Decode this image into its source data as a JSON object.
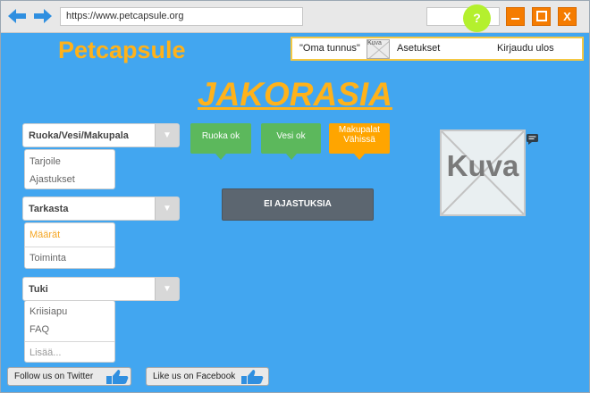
{
  "browser": {
    "url": "https://www.petcapsule.org",
    "help_label": "?",
    "minimize_label": "_",
    "maximize_label": "□",
    "close_label": "X"
  },
  "header": {
    "logo": "Petcapsule",
    "nav": {
      "my_id": "\"Oma tunnus\"",
      "thumb_label": "Kuva",
      "settings": "Asetukset",
      "logout": "Kirjaudu ulos"
    }
  },
  "main": {
    "title": "JAKORASIA",
    "status": [
      {
        "label": "Ruoka ok",
        "color": "#5cb85c"
      },
      {
        "label": "Vesi ok",
        "color": "#5cb85c"
      },
      {
        "label_line1": "Makupalat",
        "label_line2": "Vähissä",
        "color": "#ffa500"
      }
    ],
    "schedule_button": "EI AJASTUKSIA",
    "image_label": "Kuva"
  },
  "sidebar": {
    "dropdown1": {
      "label": "Ruoka/Vesi/Makupala",
      "items": [
        "Tarjoile",
        "Ajastukset"
      ]
    },
    "dropdown2": {
      "label": "Tarkasta",
      "items": [
        "Määrät",
        "Toiminta"
      ],
      "active_color": "#f5a623"
    },
    "dropdown3": {
      "label": "Tuki",
      "items": [
        "Kriisiapu",
        "FAQ",
        "Lisää..."
      ]
    }
  },
  "footer": {
    "twitter": "Follow us on Twitter",
    "facebook": "Like us on Facebook"
  },
  "colors": {
    "background": "#42a6f0",
    "accent": "#ffb21a",
    "window_button": "#f57c00",
    "help": "#b4f02e"
  },
  "icons": {
    "back": "arrow-left-icon",
    "forward": "arrow-right-icon",
    "chevron": "chevron-down-icon",
    "chat": "chat-bubble-icon",
    "thumbs_up": "thumbs-up-icon"
  }
}
